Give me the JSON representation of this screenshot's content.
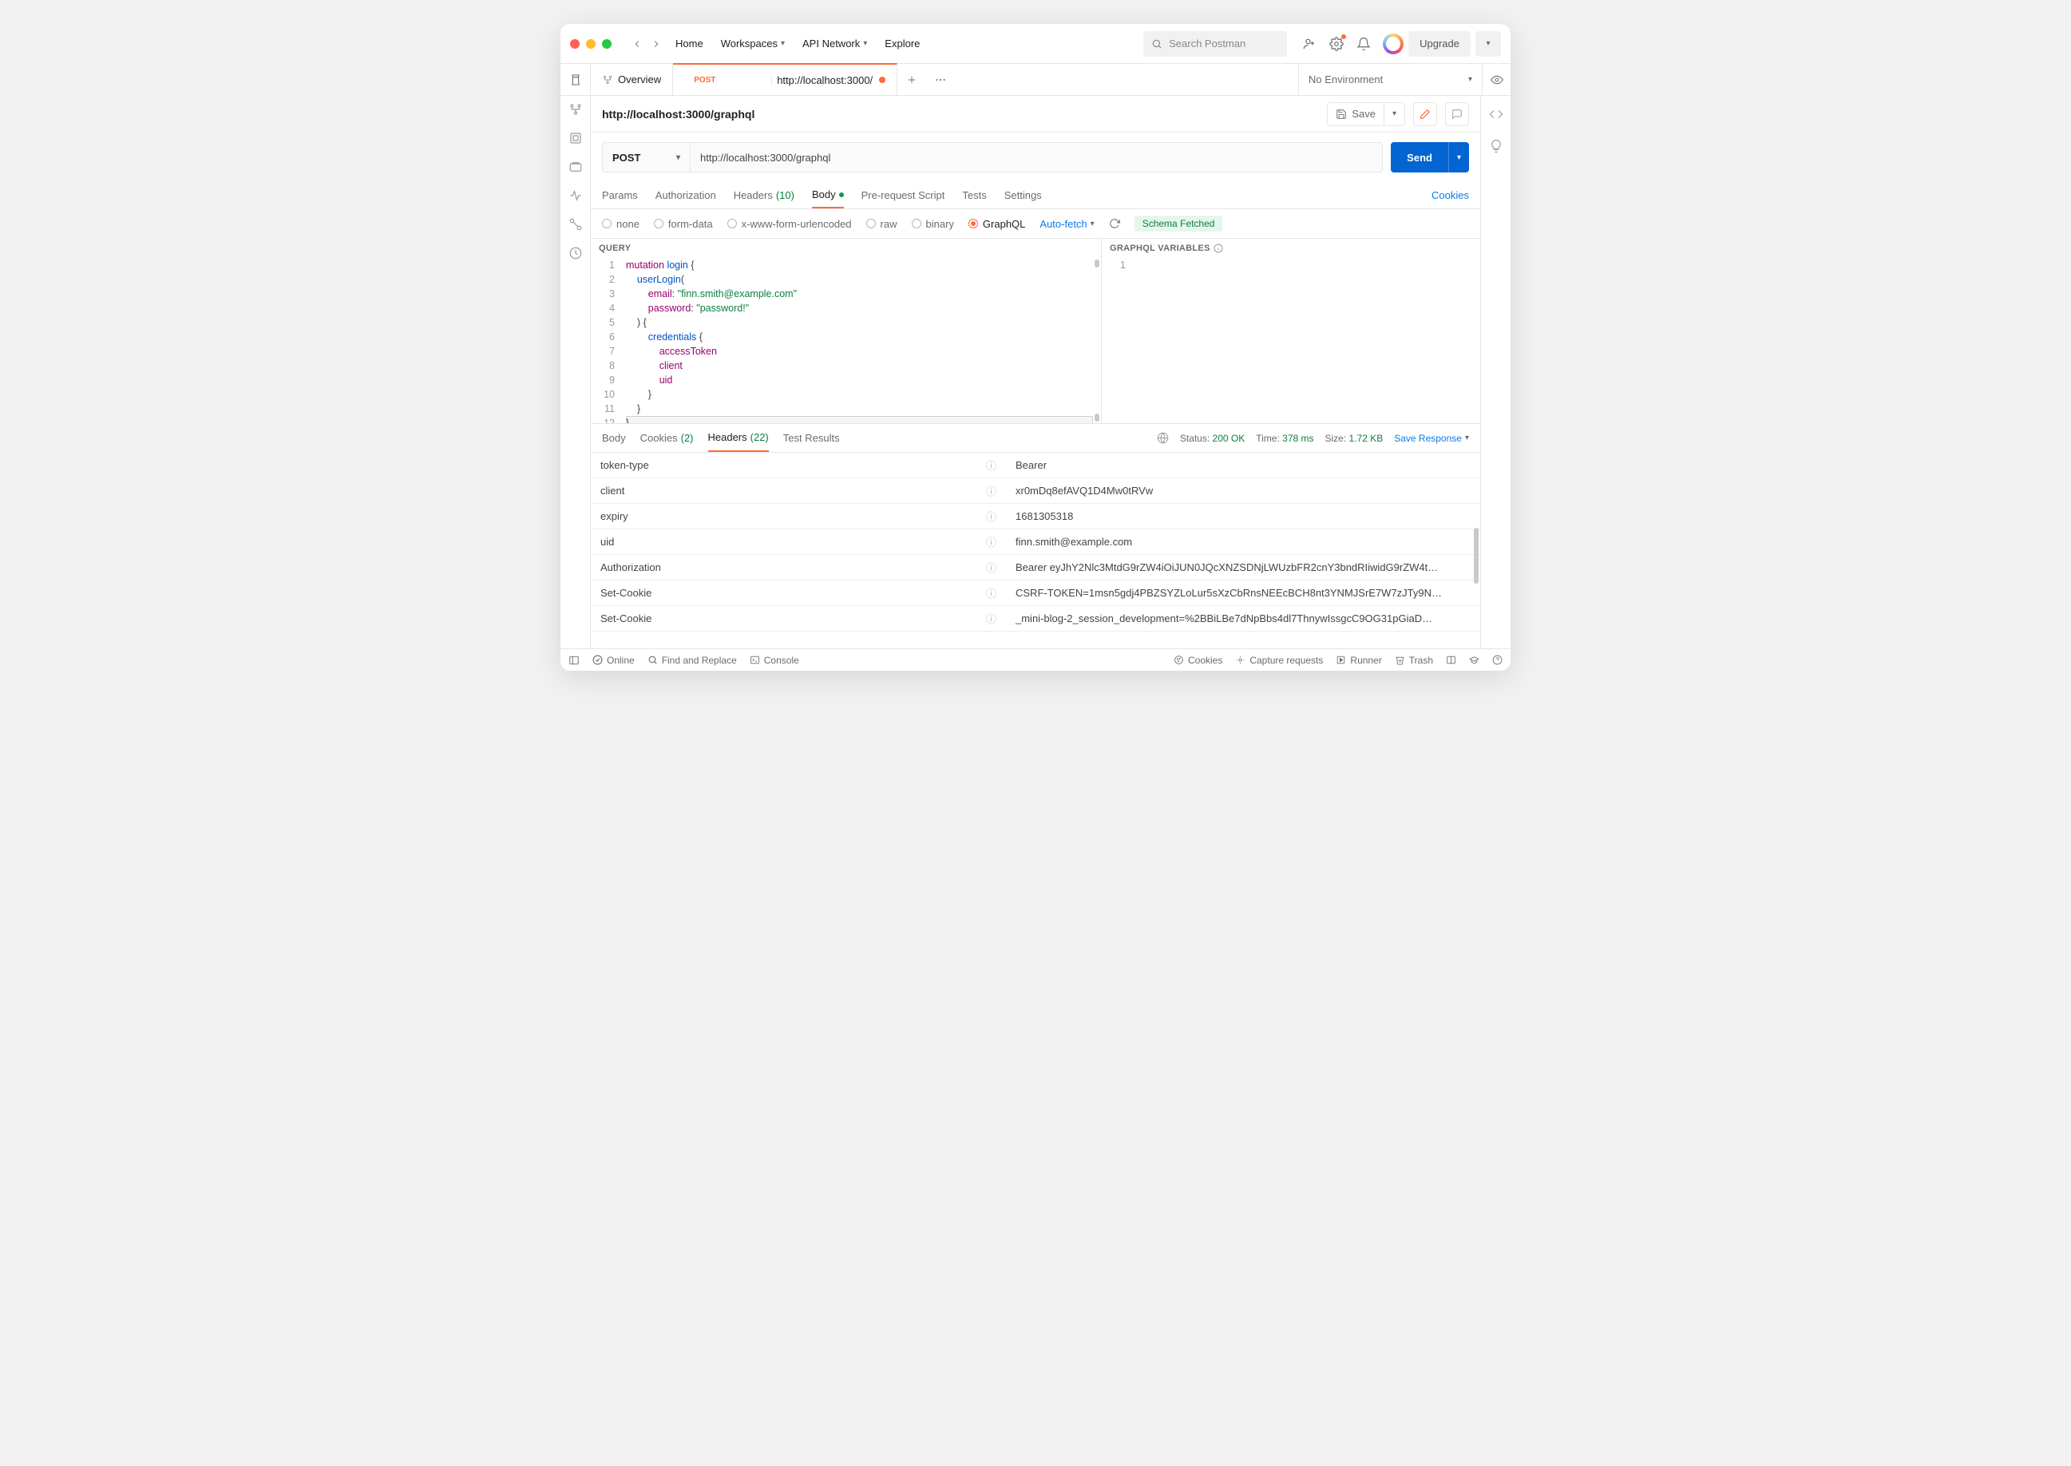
{
  "topbar": {
    "nav": [
      "Home",
      "Workspaces",
      "API Network",
      "Explore"
    ],
    "searchPlaceholder": "Search Postman",
    "upgrade": "Upgrade"
  },
  "tabs": {
    "overview": "Overview",
    "active": {
      "method": "POST",
      "title": "http://localhost:3000/"
    },
    "environment": "No Environment"
  },
  "request": {
    "title": "http://localhost:3000/graphql",
    "save": "Save",
    "method": "POST",
    "url": "http://localhost:3000/graphql",
    "send": "Send",
    "tabs": {
      "params": "Params",
      "auth": "Authorization",
      "headers": "Headers",
      "headersCount": "(10)",
      "body": "Body",
      "pre": "Pre-request Script",
      "tests": "Tests",
      "settings": "Settings",
      "cookies": "Cookies"
    },
    "bodyTypes": {
      "none": "none",
      "form": "form-data",
      "xwww": "x-www-form-urlencoded",
      "raw": "raw",
      "binary": "binary",
      "graphql": "GraphQL",
      "auto": "Auto-fetch",
      "schema": "Schema Fetched"
    },
    "queryHeader": "QUERY",
    "varsHeader": "GRAPHQL VARIABLES",
    "queryLines": [
      "mutation login {",
      "    userLogin(",
      "        email: \"finn.smith@example.com\"",
      "        password: \"password!\"",
      "    ) {",
      "        credentials {",
      "            accessToken",
      "            client",
      "            uid",
      "        }",
      "    }",
      "}"
    ]
  },
  "response": {
    "tabs": {
      "body": "Body",
      "cookies": "Cookies",
      "cookiesCount": "(2)",
      "headers": "Headers",
      "headersCount": "(22)",
      "tests": "Test Results"
    },
    "status": {
      "label": "Status:",
      "value": "200 OK"
    },
    "time": {
      "label": "Time:",
      "value": "378 ms"
    },
    "size": {
      "label": "Size:",
      "value": "1.72 KB"
    },
    "saveResponse": "Save Response",
    "headers": [
      {
        "k": "token-type",
        "v": "Bearer"
      },
      {
        "k": "client",
        "v": "xr0mDq8efAVQ1D4Mw0tRVw"
      },
      {
        "k": "expiry",
        "v": "1681305318"
      },
      {
        "k": "uid",
        "v": "finn.smith@example.com"
      },
      {
        "k": "Authorization",
        "v": "Bearer eyJhY2Nlc3MtdG9rZW4iOiJUN0JQcXNZSDNjLWUzbFR2cnY3bndRIiwidG9rZW4t…"
      },
      {
        "k": "Set-Cookie",
        "v": "CSRF-TOKEN=1msn5gdj4PBZSYZLoLur5sXzCbRnsNEEcBCH8nt3YNMJSrE7W7zJTy9N…"
      },
      {
        "k": "Set-Cookie",
        "v": "_mini-blog-2_session_development=%2BBiLBe7dNpBbs4dl7ThnywIssgcC9OG31pGiaD…"
      }
    ]
  },
  "statusbar": {
    "online": "Online",
    "find": "Find and Replace",
    "console": "Console",
    "cookies": "Cookies",
    "capture": "Capture requests",
    "runner": "Runner",
    "trash": "Trash"
  }
}
